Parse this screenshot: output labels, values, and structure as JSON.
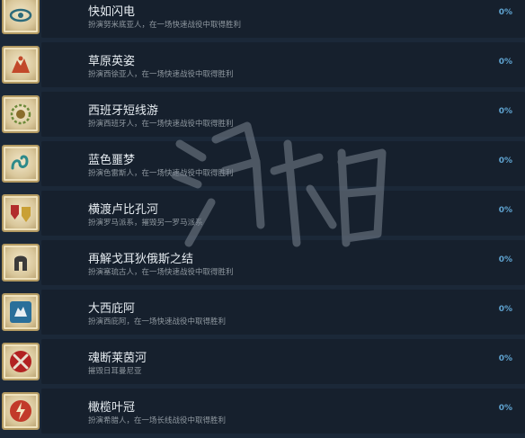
{
  "achievements": [
    {
      "title": "快如闪电",
      "desc": "扮演努米底亚人，在一场快速战役中取得胜利",
      "percent": "0%",
      "icon": "eye-emblem-icon",
      "accent": "#2c6a7a"
    },
    {
      "title": "草原英姿",
      "desc": "扮演西徐亚人，在一场快速战役中取得胜利",
      "percent": "0%",
      "icon": "horse-emblem-icon",
      "accent": "#c2492a"
    },
    {
      "title": "西班牙短线游",
      "desc": "扮演西班牙人，在一场快速战役中取得胜利",
      "percent": "0%",
      "icon": "laurel-emblem-icon",
      "accent": "#8a6d2c"
    },
    {
      "title": "蓝色噩梦",
      "desc": "扮演色雷斯人，在一场快速战役中取得胜利",
      "percent": "0%",
      "icon": "serpent-emblem-icon",
      "accent": "#2d8a8a"
    },
    {
      "title": "横渡卢比孔河",
      "desc": "扮演罗马派系，摧毁另一罗马派系",
      "percent": "0%",
      "icon": "shields-emblem-icon",
      "accent": "#b22d2d"
    },
    {
      "title": "再解戈耳狄俄斯之结",
      "desc": "扮演塞琉古人，在一场快速战役中取得胜利",
      "percent": "0%",
      "icon": "helmet-emblem-icon",
      "accent": "#3a3a3a"
    },
    {
      "title": "大西庇阿",
      "desc": "扮演西庇阿，在一场快速战役中取得胜利",
      "percent": "0%",
      "icon": "wolf-emblem-icon",
      "accent": "#2a6f9a"
    },
    {
      "title": "魂断莱茵河",
      "desc": "摧毁日耳曼尼亚",
      "percent": "0%",
      "icon": "crossed-swords-emblem-icon",
      "accent": "#b22222"
    },
    {
      "title": "橄榄叶冠",
      "desc": "扮演希腊人，在一场长线战役中取得胜利",
      "percent": "0%",
      "icon": "lightning-emblem-icon",
      "accent": "#c23a2a"
    }
  ]
}
